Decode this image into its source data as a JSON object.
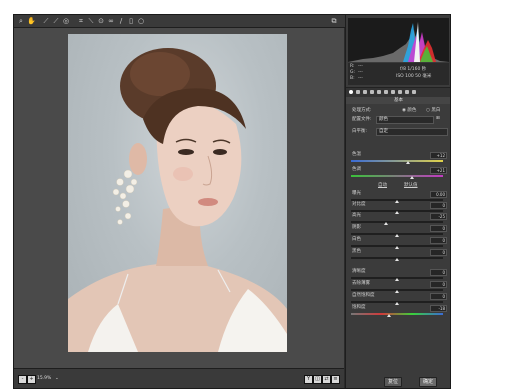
{
  "toolbar": {
    "tools": [
      "zoom-icon",
      "hand-icon",
      "eyedropper-icon",
      "color-sampler-icon",
      "targeted-adjust-icon",
      "crop-icon",
      "straighten-icon",
      "spot-removal-icon",
      "red-eye-icon",
      "adjustment-brush-icon",
      "graduated-filter-icon",
      "radial-filter-icon"
    ],
    "open_prefs_icon": "preferences-icon"
  },
  "info": {
    "r_label": "R:",
    "g_label": "G:",
    "b_label": "B:",
    "r_val": "---",
    "g_val": "---",
    "b_val": "---",
    "exposure_line": "f/8   1/160 秒",
    "iso_line": "ISO 100   50 毫米"
  },
  "panel": {
    "title": "基本",
    "process_label": "处理方式:",
    "process_color": "颜色",
    "process_bw": "黑白",
    "profile_label": "配置文件:",
    "profile_value": "颜色",
    "wb_label": "白平衡:",
    "wb_value": "自定",
    "auto_label": "自动",
    "default_label": "默认值",
    "sliders": [
      {
        "label": "色温",
        "value": "+12",
        "pos": 0.62
      },
      {
        "label": "色调",
        "value": "+21",
        "pos": 0.66
      },
      {
        "label": "曝光",
        "value": "0.00",
        "pos": 0.5
      },
      {
        "label": "对比度",
        "value": "0",
        "pos": 0.5
      },
      {
        "label": "高光",
        "value": "-25",
        "pos": 0.38
      },
      {
        "label": "阴影",
        "value": "0",
        "pos": 0.5
      },
      {
        "label": "白色",
        "value": "0",
        "pos": 0.5
      },
      {
        "label": "黑色",
        "value": "0",
        "pos": 0.5
      },
      {
        "label": "清晰度",
        "value": "0",
        "pos": 0.5
      },
      {
        "label": "去除薄雾",
        "value": "0",
        "pos": 0.5
      },
      {
        "label": "自然饱和度",
        "value": "0",
        "pos": 0.5
      },
      {
        "label": "饱和度",
        "value": "-18",
        "pos": 0.41
      }
    ]
  },
  "bottom": {
    "zoom_value": "15.9%",
    "right_buttons": [
      "Y",
      "before-after-icon",
      "swap-icon",
      "settings-icon"
    ]
  },
  "footer": {
    "reset_label": "复位",
    "ok_label": "确定"
  }
}
